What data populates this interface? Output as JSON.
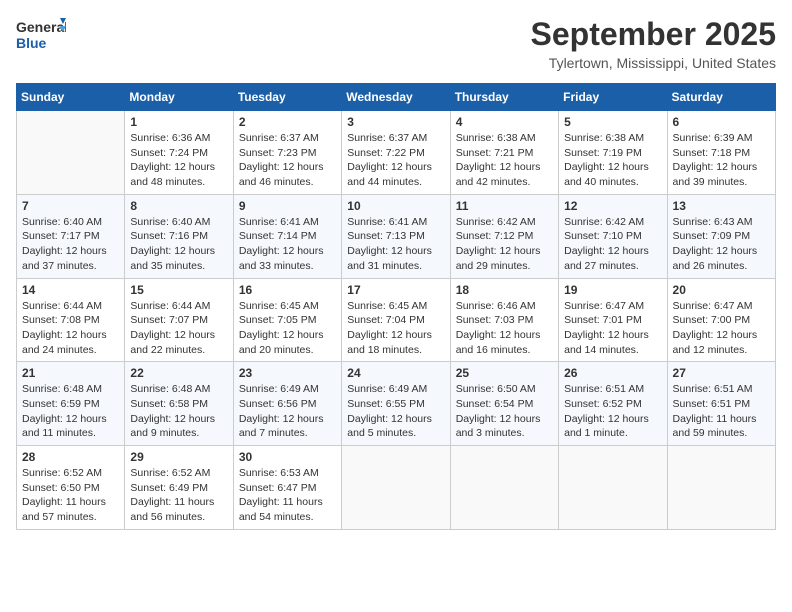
{
  "logo": {
    "line1": "General",
    "line2": "Blue"
  },
  "title": "September 2025",
  "location": "Tylertown, Mississippi, United States",
  "weekdays": [
    "Sunday",
    "Monday",
    "Tuesday",
    "Wednesday",
    "Thursday",
    "Friday",
    "Saturday"
  ],
  "weeks": [
    [
      {
        "day": "",
        "info": ""
      },
      {
        "day": "1",
        "info": "Sunrise: 6:36 AM\nSunset: 7:24 PM\nDaylight: 12 hours\nand 48 minutes."
      },
      {
        "day": "2",
        "info": "Sunrise: 6:37 AM\nSunset: 7:23 PM\nDaylight: 12 hours\nand 46 minutes."
      },
      {
        "day": "3",
        "info": "Sunrise: 6:37 AM\nSunset: 7:22 PM\nDaylight: 12 hours\nand 44 minutes."
      },
      {
        "day": "4",
        "info": "Sunrise: 6:38 AM\nSunset: 7:21 PM\nDaylight: 12 hours\nand 42 minutes."
      },
      {
        "day": "5",
        "info": "Sunrise: 6:38 AM\nSunset: 7:19 PM\nDaylight: 12 hours\nand 40 minutes."
      },
      {
        "day": "6",
        "info": "Sunrise: 6:39 AM\nSunset: 7:18 PM\nDaylight: 12 hours\nand 39 minutes."
      }
    ],
    [
      {
        "day": "7",
        "info": "Sunrise: 6:40 AM\nSunset: 7:17 PM\nDaylight: 12 hours\nand 37 minutes."
      },
      {
        "day": "8",
        "info": "Sunrise: 6:40 AM\nSunset: 7:16 PM\nDaylight: 12 hours\nand 35 minutes."
      },
      {
        "day": "9",
        "info": "Sunrise: 6:41 AM\nSunset: 7:14 PM\nDaylight: 12 hours\nand 33 minutes."
      },
      {
        "day": "10",
        "info": "Sunrise: 6:41 AM\nSunset: 7:13 PM\nDaylight: 12 hours\nand 31 minutes."
      },
      {
        "day": "11",
        "info": "Sunrise: 6:42 AM\nSunset: 7:12 PM\nDaylight: 12 hours\nand 29 minutes."
      },
      {
        "day": "12",
        "info": "Sunrise: 6:42 AM\nSunset: 7:10 PM\nDaylight: 12 hours\nand 27 minutes."
      },
      {
        "day": "13",
        "info": "Sunrise: 6:43 AM\nSunset: 7:09 PM\nDaylight: 12 hours\nand 26 minutes."
      }
    ],
    [
      {
        "day": "14",
        "info": "Sunrise: 6:44 AM\nSunset: 7:08 PM\nDaylight: 12 hours\nand 24 minutes."
      },
      {
        "day": "15",
        "info": "Sunrise: 6:44 AM\nSunset: 7:07 PM\nDaylight: 12 hours\nand 22 minutes."
      },
      {
        "day": "16",
        "info": "Sunrise: 6:45 AM\nSunset: 7:05 PM\nDaylight: 12 hours\nand 20 minutes."
      },
      {
        "day": "17",
        "info": "Sunrise: 6:45 AM\nSunset: 7:04 PM\nDaylight: 12 hours\nand 18 minutes."
      },
      {
        "day": "18",
        "info": "Sunrise: 6:46 AM\nSunset: 7:03 PM\nDaylight: 12 hours\nand 16 minutes."
      },
      {
        "day": "19",
        "info": "Sunrise: 6:47 AM\nSunset: 7:01 PM\nDaylight: 12 hours\nand 14 minutes."
      },
      {
        "day": "20",
        "info": "Sunrise: 6:47 AM\nSunset: 7:00 PM\nDaylight: 12 hours\nand 12 minutes."
      }
    ],
    [
      {
        "day": "21",
        "info": "Sunrise: 6:48 AM\nSunset: 6:59 PM\nDaylight: 12 hours\nand 11 minutes."
      },
      {
        "day": "22",
        "info": "Sunrise: 6:48 AM\nSunset: 6:58 PM\nDaylight: 12 hours\nand 9 minutes."
      },
      {
        "day": "23",
        "info": "Sunrise: 6:49 AM\nSunset: 6:56 PM\nDaylight: 12 hours\nand 7 minutes."
      },
      {
        "day": "24",
        "info": "Sunrise: 6:49 AM\nSunset: 6:55 PM\nDaylight: 12 hours\nand 5 minutes."
      },
      {
        "day": "25",
        "info": "Sunrise: 6:50 AM\nSunset: 6:54 PM\nDaylight: 12 hours\nand 3 minutes."
      },
      {
        "day": "26",
        "info": "Sunrise: 6:51 AM\nSunset: 6:52 PM\nDaylight: 12 hours\nand 1 minute."
      },
      {
        "day": "27",
        "info": "Sunrise: 6:51 AM\nSunset: 6:51 PM\nDaylight: 11 hours\nand 59 minutes."
      }
    ],
    [
      {
        "day": "28",
        "info": "Sunrise: 6:52 AM\nSunset: 6:50 PM\nDaylight: 11 hours\nand 57 minutes."
      },
      {
        "day": "29",
        "info": "Sunrise: 6:52 AM\nSunset: 6:49 PM\nDaylight: 11 hours\nand 56 minutes."
      },
      {
        "day": "30",
        "info": "Sunrise: 6:53 AM\nSunset: 6:47 PM\nDaylight: 11 hours\nand 54 minutes."
      },
      {
        "day": "",
        "info": ""
      },
      {
        "day": "",
        "info": ""
      },
      {
        "day": "",
        "info": ""
      },
      {
        "day": "",
        "info": ""
      }
    ]
  ]
}
